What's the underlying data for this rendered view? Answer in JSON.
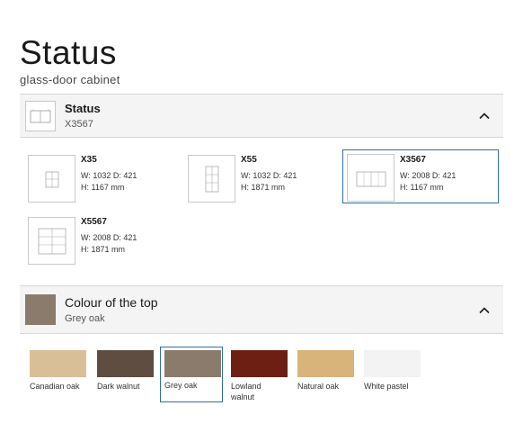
{
  "page": {
    "title": "Status",
    "subtitle": "glass-door cabinet"
  },
  "status_section": {
    "title": "Status",
    "value": "X3567",
    "thumb_icon": "cabinet-icon",
    "toggle_icon": "chevron-up-icon"
  },
  "models": [
    {
      "name": "X35",
      "dim1": "W: 1032 D: 421",
      "dim2": "H: 1167 mm",
      "selected": false
    },
    {
      "name": "X55",
      "dim1": "W: 1032 D: 421",
      "dim2": "H: 1871 mm",
      "selected": false
    },
    {
      "name": "X3567",
      "dim1": "W: 2008 D: 421",
      "dim2": "H: 1167 mm",
      "selected": true
    },
    {
      "name": "X5567",
      "dim1": "W: 2008 D: 421",
      "dim2": "H: 1871 mm",
      "selected": false
    }
  ],
  "colour_section": {
    "title": "Colour of the top",
    "value": "Grey oak",
    "toggle_icon": "chevron-up-icon"
  },
  "colours": [
    {
      "label": "Canadian oak",
      "color": "#d9bf98",
      "selected": false
    },
    {
      "label": "Dark walnut",
      "color": "#5e4d40",
      "selected": false
    },
    {
      "label": "Grey oak",
      "color": "#8a7b6c",
      "selected": true
    },
    {
      "label": "Lowland walnut",
      "color": "#6e1f14",
      "selected": false
    },
    {
      "label": "Natural oak",
      "color": "#d8b37a",
      "selected": false
    },
    {
      "label": "White pastel",
      "color": "#f3f3f3",
      "selected": false
    }
  ],
  "colors": {
    "accent": "#2f6ea8",
    "header_bg": "#f4f4f4",
    "border": "#d6d6d6"
  }
}
